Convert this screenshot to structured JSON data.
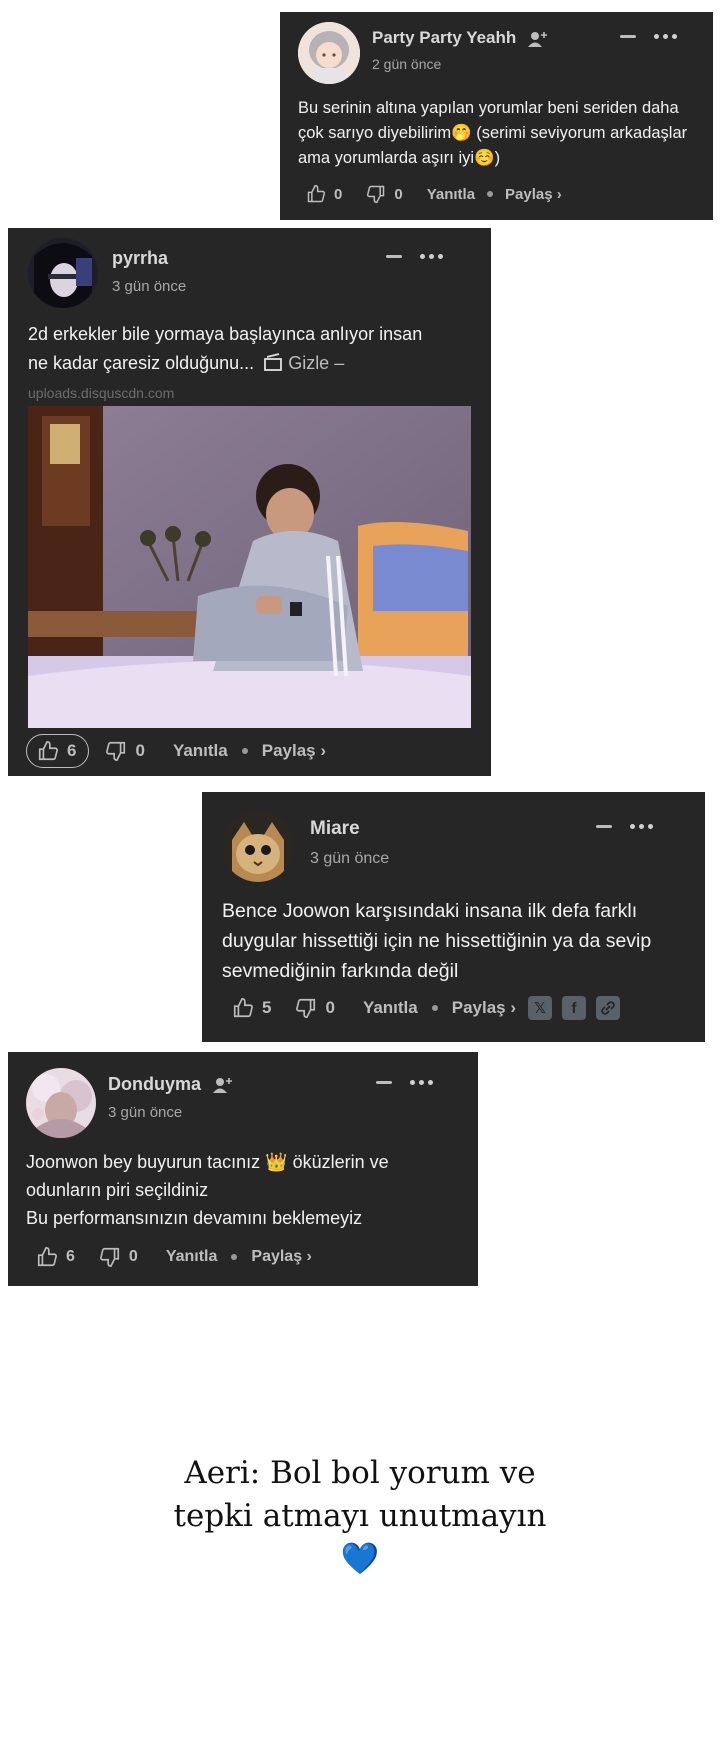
{
  "comments": [
    {
      "username": "Party Party Yeahh",
      "time": "2 gün önce",
      "text": "Bu serinin altına yapılan yorumlar beni seriden daha çok sarıyo diyebilirim🤭 (serimi seviyorum arkadaşlar ama yorumlarda aşırı iyi☺️)",
      "likes": "0",
      "dislikes": "0",
      "reply": "Yanıtla",
      "share": "Paylaş ›"
    },
    {
      "username": "pyrrha",
      "time": "3 gün önce",
      "text_line1": "2d erkekler bile yormaya başlayınca anlıyor insan",
      "text_line2": "ne kadar çaresiz olduğunu...",
      "hide_label": "Gizle –",
      "source": "uploads.disquscdn.com",
      "likes": "6",
      "dislikes": "0",
      "reply": "Yanıtla",
      "share": "Paylaş ›"
    },
    {
      "username": "Miare",
      "time": "3 gün önce",
      "text": "Bence Joowon karşısındaki insana ilk defa farklı duygular hissettiği için ne hissettiğinin ya da sevip sevmediğinin farkında değil",
      "likes": "5",
      "dislikes": "0",
      "reply": "Yanıtla",
      "share": "Paylaş ›"
    },
    {
      "username": "Donduyma",
      "time": "3 gün önce",
      "text_line1": "Joonwon bey buyurun tacınız 👑 öküzlerin ve odunların piri seçildiniz",
      "text_line2": "Bu performansınızın devamını beklemeyiz",
      "likes": "6",
      "dislikes": "0",
      "reply": "Yanıtla",
      "share": "Paylaş ›"
    }
  ],
  "closing": {
    "line1": "Aeri: Bol bol yorum ve",
    "line2": "tepki atmayı unutmayın",
    "heart": "💙"
  },
  "colors": {
    "card_bg": "#262626",
    "text": "#f1f1f1",
    "muted": "#a8a8a8"
  }
}
